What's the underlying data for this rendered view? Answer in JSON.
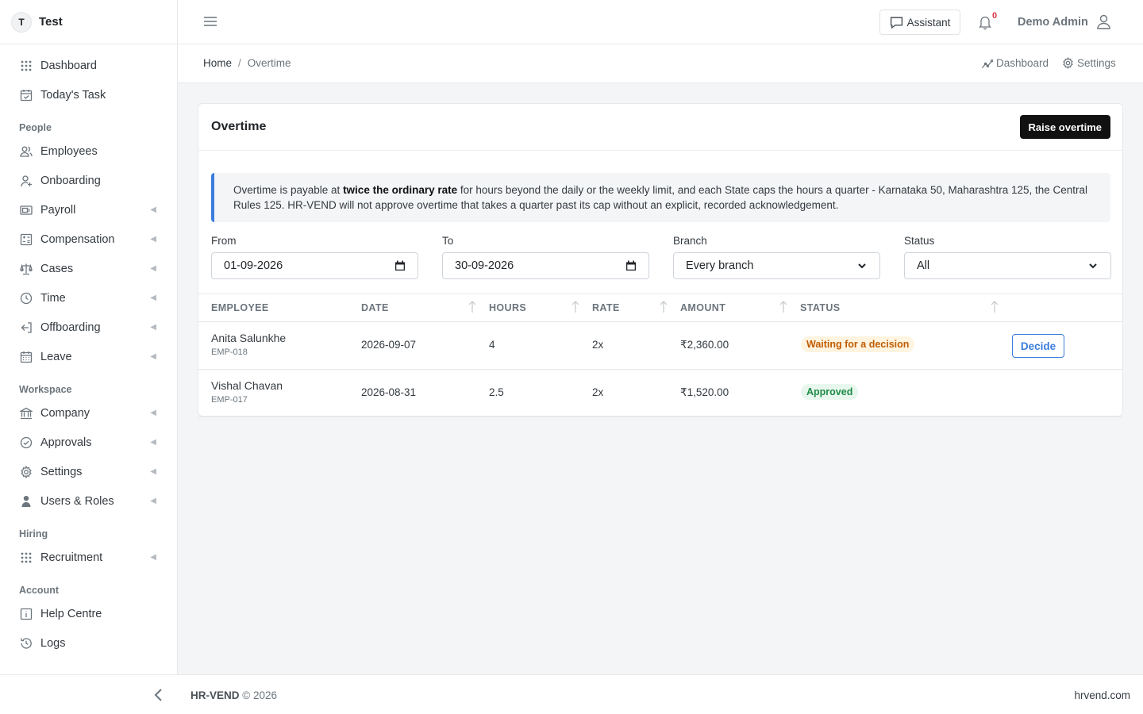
{
  "brand": {
    "initial": "T",
    "name": "Test"
  },
  "sidebar": {
    "top_items": [
      {
        "label": "Dashboard",
        "icon": "grid-dots-icon"
      },
      {
        "label": "Today's Task",
        "icon": "calendar-check-icon"
      }
    ],
    "sections": [
      {
        "title": "People",
        "items": [
          {
            "label": "Employees",
            "icon": "users-icon",
            "chevron": false
          },
          {
            "label": "Onboarding",
            "icon": "user-plus-icon",
            "chevron": false
          },
          {
            "label": "Payroll",
            "icon": "cash-icon",
            "chevron": true
          },
          {
            "label": "Compensation",
            "icon": "calculator-icon",
            "chevron": true
          },
          {
            "label": "Cases",
            "icon": "scale-icon",
            "chevron": true
          },
          {
            "label": "Time",
            "icon": "clock-icon",
            "chevron": true
          },
          {
            "label": "Offboarding",
            "icon": "logout-icon",
            "chevron": true
          },
          {
            "label": "Leave",
            "icon": "calendar-icon",
            "chevron": true
          }
        ]
      },
      {
        "title": "Workspace",
        "items": [
          {
            "label": "Company",
            "icon": "bank-icon",
            "chevron": true
          },
          {
            "label": "Approvals",
            "icon": "check-circle-icon",
            "chevron": true
          },
          {
            "label": "Settings",
            "icon": "gear-icon",
            "chevron": true
          },
          {
            "label": "Users & Roles",
            "icon": "user-shield-icon",
            "chevron": true
          }
        ]
      },
      {
        "title": "Hiring",
        "items": [
          {
            "label": "Recruitment",
            "icon": "grid-dots-icon",
            "chevron": true
          }
        ]
      },
      {
        "title": "Account",
        "items": [
          {
            "label": "Help Centre",
            "icon": "info-box-icon",
            "chevron": false
          },
          {
            "label": "Logs",
            "icon": "history-icon",
            "chevron": false
          }
        ]
      }
    ]
  },
  "header": {
    "assistant_label": "Assistant",
    "notification_count": "0",
    "user_name": "Demo Admin"
  },
  "breadcrumb": {
    "home": "Home",
    "separator": "/",
    "current": "Overtime",
    "quick_dashboard": "Dashboard",
    "quick_settings": "Settings"
  },
  "card": {
    "title": "Overtime",
    "raise_label": "Raise overtime",
    "note_before": "Overtime is payable at ",
    "note_bold": "twice the ordinary rate",
    "note_after": " for hours beyond the daily or the weekly limit, and each State caps the hours a quarter - Karnataka 50, Maharashtra 125, the Central Rules 125. HR-VEND will not approve overtime that takes a quarter past its cap without an explicit, recorded acknowledgement."
  },
  "filters": {
    "from_label": "From",
    "from_value": "01-09-2026",
    "to_label": "To",
    "to_value": "30-09-2026",
    "branch_label": "Branch",
    "branch_value": "Every branch",
    "status_label": "Status",
    "status_value": "All"
  },
  "table": {
    "headers": [
      "EMPLOYEE",
      "DATE",
      "HOURS",
      "RATE",
      "AMOUNT",
      "STATUS"
    ],
    "rows": [
      {
        "name": "Anita Salunkhe",
        "code": "EMP-018",
        "date": "2026-09-07",
        "hours": "4",
        "rate": "2x",
        "amount": "₹2,360.00",
        "status": "Waiting for a decision",
        "action": "Decide"
      },
      {
        "name": "Vishal Chavan",
        "code": "EMP-017",
        "date": "2026-08-31",
        "hours": "2.5",
        "rate": "2x",
        "amount": "₹1,520.00",
        "status": "Approved",
        "action": ""
      }
    ]
  },
  "footer": {
    "brand": "HR-VEND",
    "copyright": "© 2026",
    "site": "hrvend.com"
  },
  "colors": {
    "accent_blue": "#3b7ddd",
    "warn_text": "#c15c00",
    "warn_bg": "#fff4e0",
    "ok_text": "#1e8a46",
    "ok_bg": "#e8f7ee",
    "primary_button": "#111111",
    "notification_red": "#dc3545"
  }
}
